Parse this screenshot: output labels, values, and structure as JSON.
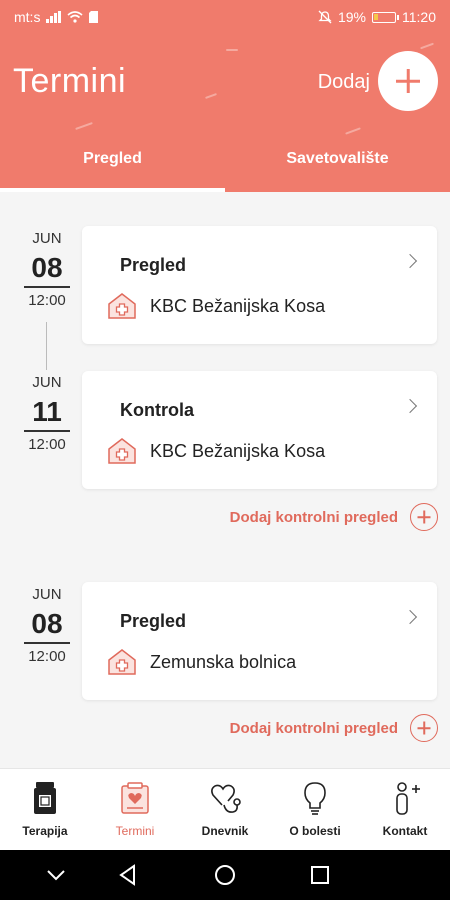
{
  "status_bar": {
    "carrier": "mt:s",
    "battery_percent": "19%",
    "time": "11:20",
    "icons": [
      "signal-icon",
      "wifi-icon",
      "sim-icon",
      "mute-icon",
      "battery-icon"
    ]
  },
  "header": {
    "title": "Termini",
    "add_label": "Dodaj",
    "background_color": "#f07b6c"
  },
  "tabs": [
    {
      "label": "Pregled",
      "active": true
    },
    {
      "label": "Savetovalište",
      "active": false
    }
  ],
  "appointments": [
    {
      "month": "JUN",
      "day": "08",
      "time": "12:00",
      "type": "Pregled",
      "location": "KBC Bežanijska Kosa"
    },
    {
      "month": "JUN",
      "day": "11",
      "time": "12:00",
      "type": "Kontrola",
      "location": "KBC Bežanijska Kosa"
    },
    {
      "month": "JUN",
      "day": "08",
      "time": "12:00",
      "type": "Pregled",
      "location": "Zemunska bolnica"
    }
  ],
  "add_followup_label": "Dodaj kontrolni pregled",
  "bottom_nav": [
    {
      "label": "Terapija",
      "icon": "medicine-jar-icon",
      "active": false
    },
    {
      "label": "Termini",
      "icon": "calendar-heart-icon",
      "active": true
    },
    {
      "label": "Dnevnik",
      "icon": "heart-stethoscope-icon",
      "active": false
    },
    {
      "label": "O bolesti",
      "icon": "lightbulb-icon",
      "active": false
    },
    {
      "label": "Kontakt",
      "icon": "add-contact-icon",
      "active": false
    }
  ],
  "accent_color": "#e06a5c"
}
